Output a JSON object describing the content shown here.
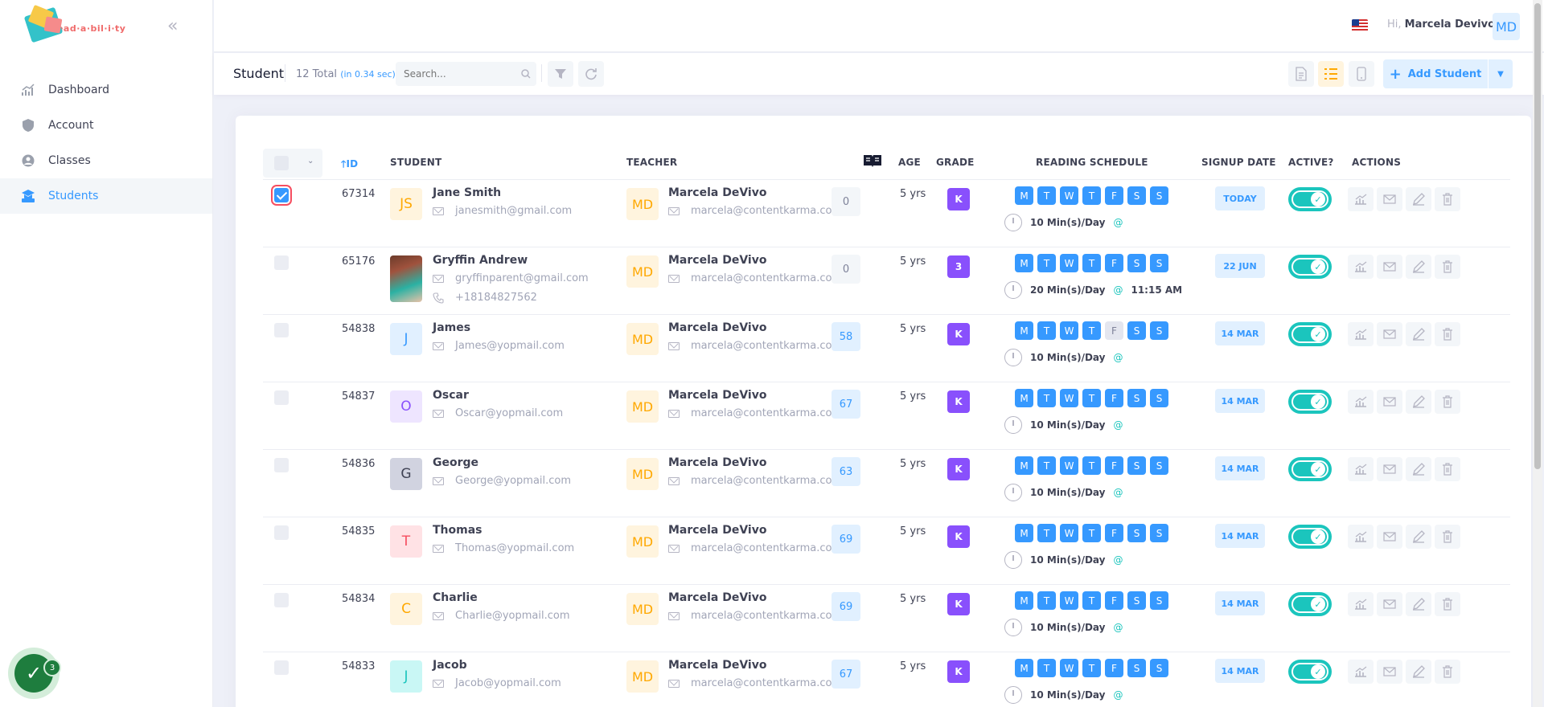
{
  "brand": {
    "logo_text": "Read·a·bil·i·ty"
  },
  "sidebar": {
    "items": [
      {
        "label": "Dashboard",
        "icon": "chart-icon"
      },
      {
        "label": "Account",
        "icon": "shield-icon"
      },
      {
        "label": "Classes",
        "icon": "classes-icon"
      },
      {
        "label": "Students",
        "icon": "student-icon",
        "active": true
      }
    ]
  },
  "header": {
    "greeting_prefix": "Hi,",
    "user_name": "Marcela Devivo",
    "user_initials": "MD",
    "language_flag": "us-flag-icon"
  },
  "subheader": {
    "title": "Student",
    "total": "12 Total",
    "time": "(in 0.34 sec)",
    "search_placeholder": "Search...",
    "add_label": "Add Student"
  },
  "table": {
    "headers": {
      "id": "ID",
      "student": "Student",
      "teacher": "Teacher",
      "age": "Age",
      "grade": "Grade",
      "schedule": "Reading Schedule",
      "signup": "Signup Date",
      "active": "Active?",
      "actions": "Actions"
    },
    "rows": [
      {
        "id": "67314",
        "initials": "JS",
        "av_bg": "#fff4de",
        "av_fg": "#ffa800",
        "name": "Jane Smith",
        "email": "janesmith@gmail.com",
        "teacher": "Marcela DeVivo",
        "teacher_email": "marcela@contentkarma.com",
        "books": "0",
        "age": "5 yrs",
        "grade": "K",
        "off_days": [],
        "schedule": "10 Min(s)/Day",
        "time": "",
        "signup": "TODAY",
        "checked": true
      },
      {
        "id": "65176",
        "initials": "",
        "photo": true,
        "name": "Gryffin Andrew",
        "email": "gryffinparent@gmail.com",
        "phone": "+18184827562",
        "teacher": "Marcela DeVivo",
        "teacher_email": "marcela@contentkarma.com",
        "books": "0",
        "age": "5 yrs",
        "grade": "3",
        "off_days": [],
        "schedule": "20 Min(s)/Day",
        "time": "11:15 AM",
        "signup": "22 JUN"
      },
      {
        "id": "54838",
        "initials": "J",
        "av_bg": "#e1f0ff",
        "av_fg": "#3699ff",
        "name": "James",
        "email": "James@yopmail.com",
        "teacher": "Marcela DeVivo",
        "teacher_email": "marcela@contentkarma.com",
        "books": "58",
        "age": "5 yrs",
        "grade": "K",
        "off_days": [
          4
        ],
        "schedule": "10 Min(s)/Day",
        "time": "",
        "signup": "14 MAR"
      },
      {
        "id": "54837",
        "initials": "O",
        "av_bg": "#eee5ff",
        "av_fg": "#8950fc",
        "name": "Oscar",
        "email": "Oscar@yopmail.com",
        "teacher": "Marcela DeVivo",
        "teacher_email": "marcela@contentkarma.com",
        "books": "67",
        "age": "5 yrs",
        "grade": "K",
        "off_days": [],
        "schedule": "10 Min(s)/Day",
        "time": "",
        "signup": "14 MAR"
      },
      {
        "id": "54836",
        "initials": "G",
        "av_bg": "#d1d3e0",
        "av_fg": "#3f4254",
        "name": "George",
        "email": "George@yopmail.com",
        "teacher": "Marcela DeVivo",
        "teacher_email": "marcela@contentkarma.com",
        "books": "63",
        "age": "5 yrs",
        "grade": "K",
        "off_days": [],
        "schedule": "10 Min(s)/Day",
        "time": "",
        "signup": "14 MAR"
      },
      {
        "id": "54835",
        "initials": "T",
        "av_bg": "#ffe2e5",
        "av_fg": "#f64e60",
        "name": "Thomas",
        "email": "Thomas@yopmail.com",
        "teacher": "Marcela DeVivo",
        "teacher_email": "marcela@contentkarma.com",
        "books": "69",
        "age": "5 yrs",
        "grade": "K",
        "off_days": [],
        "schedule": "10 Min(s)/Day",
        "time": "",
        "signup": "14 MAR"
      },
      {
        "id": "54834",
        "initials": "C",
        "av_bg": "#fff4de",
        "av_fg": "#ffa800",
        "name": "Charlie",
        "email": "Charlie@yopmail.com",
        "teacher": "Marcela DeVivo",
        "teacher_email": "marcela@contentkarma.com",
        "books": "69",
        "age": "5 yrs",
        "grade": "K",
        "off_days": [],
        "schedule": "10 Min(s)/Day",
        "time": "",
        "signup": "14 MAR"
      },
      {
        "id": "54833",
        "initials": "J",
        "av_bg": "#c9f7f5",
        "av_fg": "#1bc5bd",
        "name": "Jacob",
        "email": "Jacob@yopmail.com",
        "teacher": "Marcela DeVivo",
        "teacher_email": "marcela@contentkarma.com",
        "books": "67",
        "age": "5 yrs",
        "grade": "K",
        "off_days": [],
        "schedule": "10 Min(s)/Day",
        "time": "",
        "signup": "14 MAR"
      }
    ],
    "days": [
      "M",
      "T",
      "W",
      "T",
      "F",
      "S",
      "S"
    ],
    "at": "@"
  },
  "fab": {
    "count": "3"
  },
  "colors": {
    "accent": "#3699ff",
    "success": "#1bc5bd",
    "grade": "#8950fc",
    "warning": "#ffa800"
  }
}
